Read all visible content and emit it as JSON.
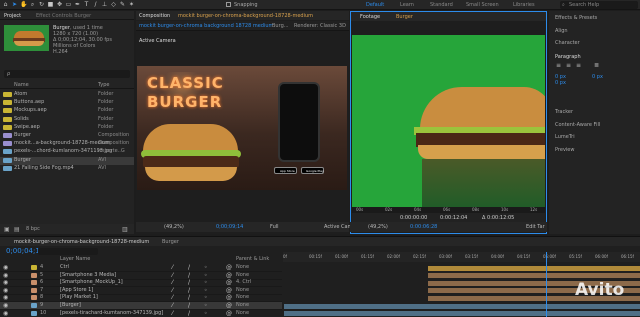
{
  "toolbar": {
    "snapping": "Snapping",
    "workspaces": [
      "Default",
      "Learn",
      "Standard",
      "Small Screen",
      "Libraries"
    ],
    "active_workspace": "Default",
    "search_placeholder": "Search Help"
  },
  "project": {
    "tab": "Project",
    "effect_controls": "Effect Controls Burger",
    "item_name": "Burger",
    "used": ", used 1 time",
    "res": "1280 x 720 (1.00)",
    "duration": "Δ 0;00;12;04, 30.00 fps",
    "colors": "Millions of Colors",
    "codec": "H.264",
    "search_placeholder": "ρ",
    "headers": {
      "name": "Name",
      "type": "Type"
    },
    "items": [
      {
        "name": "Atom",
        "type": "Folder",
        "color": "#c9b534"
      },
      {
        "name": "Buttons.aep",
        "type": "Folder",
        "color": "#c9b534"
      },
      {
        "name": "Mockups.aep",
        "type": "Folder",
        "color": "#c9b534"
      },
      {
        "name": "Solids",
        "type": "Folder",
        "color": "#c9b534"
      },
      {
        "name": "Swipe.aep",
        "type": "Folder",
        "color": "#c9b534"
      },
      {
        "name": "Burger",
        "type": "Composition",
        "color": "#9a8fcf"
      },
      {
        "name": "mockit...a-background-18728-medium",
        "type": "Composition",
        "color": "#9a8fcf"
      },
      {
        "name": "pexels-...chord-kumlanom-3471193.jpg",
        "type": "Importe..G",
        "color": "#6aa3c9"
      },
      {
        "name": "Burger",
        "type": "AVI",
        "color": "#6aa3c9"
      },
      {
        "name": "21 Falling Side Fog.mp4",
        "type": "AVI",
        "color": "#6aa3c9"
      }
    ],
    "bpc": "8 bpc"
  },
  "composition": {
    "tab": "Composition",
    "comp_name": "mockit burger-on-chroma-background-18728-medium",
    "sub_tab": "mockit burger-on-chroma background 18728 medium",
    "sub_tab2": "Burg...",
    "renderer_label": "Renderer:",
    "renderer": "Classic 3D",
    "active_camera": "Active Camera",
    "title_line1": "CLASSIC",
    "title_line2": "BURGER",
    "zoom": "(49,2%)",
    "timecode": "0;00;09;14",
    "resolution": "Full",
    "camera_btn": "Active Cam",
    "store1": "App Store",
    "store2": "Google Play"
  },
  "footage": {
    "tab": "Footage",
    "name": "Burger",
    "ruler": [
      "00s",
      "02s",
      "04s",
      "06s",
      "08s",
      "10s",
      "12s"
    ],
    "in": "0:00:00:00",
    "out": "0:00:12:04",
    "dur": "Δ 0:00:12:05",
    "zoom": "(49,2%)",
    "timecode": "0:00:06:28",
    "edit_target": "Edit Tar"
  },
  "right_panel": {
    "effects": "Effects & Presets",
    "align": "Align",
    "character": "Character",
    "paragraph": "Paragraph",
    "px": [
      "0 px",
      "0 px",
      "0 px"
    ],
    "tracker": "Tracker",
    "cae": "Content-Aware Fill",
    "lumetri": "LumeTri",
    "preview": "Preview"
  },
  "timeline": {
    "tab1": "mockit-burger-on-chroma-background-18728-medium",
    "tab2": "Burger",
    "timecode": "0;00;04;14",
    "header": {
      "layer_name": "Layer Name",
      "parent": "Parent & Link"
    },
    "layers": [
      {
        "num": "4",
        "name": "Ctrl",
        "parent": "None",
        "color": "#c9b534"
      },
      {
        "num": "5",
        "name": "[Smartphone 3 Media]",
        "parent": "None",
        "color": "#c98f6a"
      },
      {
        "num": "6",
        "name": "[Smartphone_MockUp_1]",
        "parent": "4. Ctrl",
        "color": "#c98f6a"
      },
      {
        "num": "7",
        "name": "[App Store 1]",
        "parent": "None",
        "color": "#c98f6a"
      },
      {
        "num": "8",
        "name": "[Play Market 1]",
        "parent": "None",
        "color": "#c98f6a"
      },
      {
        "num": "9",
        "name": "[Burger]",
        "parent": "None",
        "color": "#6aa3c9"
      },
      {
        "num": "10",
        "name": "[pexels-tirachard-kumtanom-347139.jpg]",
        "parent": "None",
        "color": "#6aa3c9"
      }
    ],
    "ruler": [
      "0f",
      "00:15f",
      "01:00f",
      "01:15f",
      "02:00f",
      "02:15f",
      "03:00f",
      "03:15f",
      "04:00f",
      "04:15f",
      "05:00f",
      "05:15f",
      "06:00f",
      "06:15f"
    ]
  },
  "watermark": "Avito",
  "colors": {
    "accent": "#2d8ceb",
    "green_screen": "#26a53a"
  }
}
